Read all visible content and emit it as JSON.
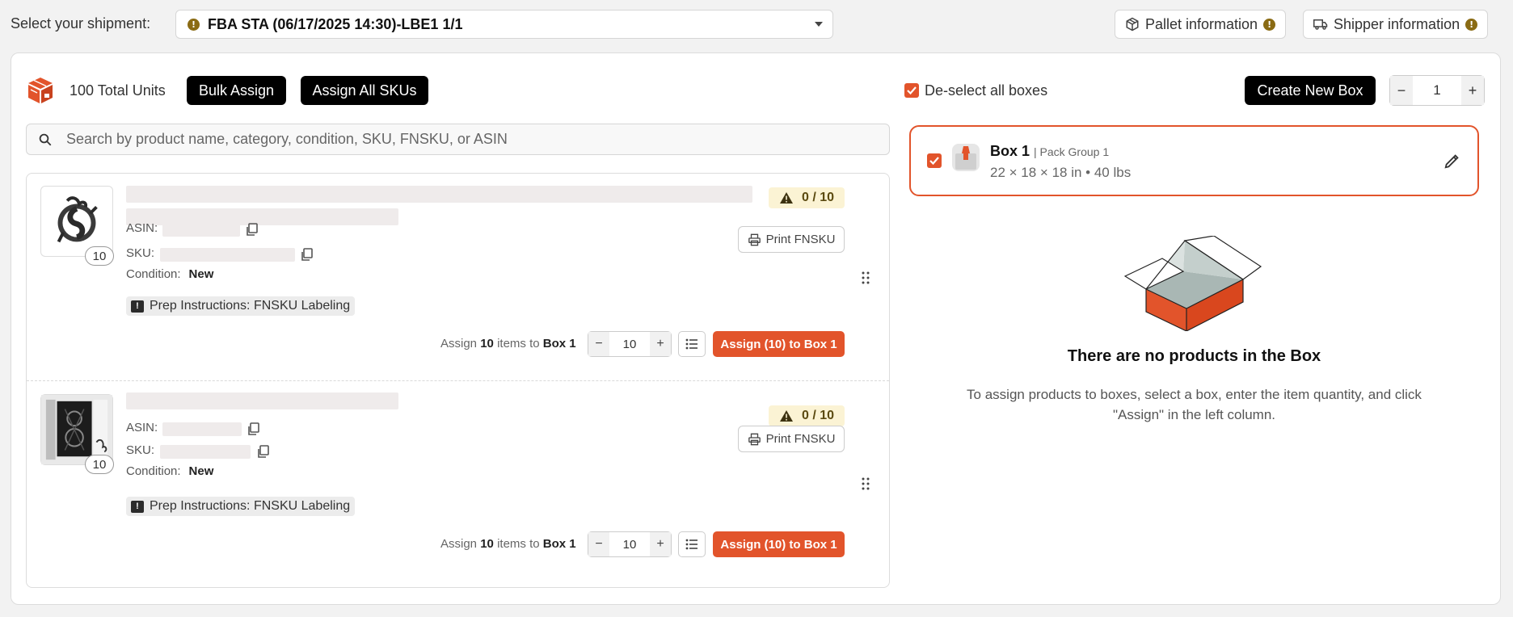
{
  "top": {
    "shipment_label": "Select your shipment:",
    "shipment_value": "FBA STA (06/17/2025 14:30)-LBE1 1/1",
    "pallet_btn": "Pallet information",
    "shipper_btn": "Shipper information",
    "warn_glyph": "!"
  },
  "toolbar": {
    "total_units": "100 Total Units",
    "bulk_assign": "Bulk Assign",
    "assign_all": "Assign All SKUs",
    "search_placeholder": "Search by product name, category, condition, SKU, FNSKU, or ASIN"
  },
  "products": [
    {
      "image_count": "10",
      "asin_label": "ASIN:",
      "sku_label": "SKU:",
      "condition_label": "Condition:",
      "condition_value": "New",
      "prep": "Prep Instructions: FNSKU Labeling",
      "qty_badge": "0 / 10",
      "print_label": "Print FNSKU",
      "assign_prefix": "Assign",
      "assign_count": "10",
      "assign_middle": "items to",
      "assign_box": "Box 1",
      "stepper_value": "10",
      "assign_button": "Assign (10) to Box 1"
    },
    {
      "image_count": "10",
      "asin_label": "ASIN:",
      "sku_label": "SKU:",
      "condition_label": "Condition:",
      "condition_value": "New",
      "prep": "Prep Instructions: FNSKU Labeling",
      "qty_badge": "0 / 10",
      "print_label": "Print FNSKU",
      "assign_prefix": "Assign",
      "assign_count": "10",
      "assign_middle": "items to",
      "assign_box": "Box 1",
      "stepper_value": "10",
      "assign_button": "Assign (10) to Box 1"
    }
  ],
  "right": {
    "deselect_label": "De-select all boxes",
    "create_box": "Create New Box",
    "box_count": "1",
    "box": {
      "name": "Box 1",
      "group": "| Pack Group 1",
      "dims": "22 × 18 × 18 in • 40 lbs"
    },
    "empty_title": "There are no products in the Box",
    "empty_desc": "To assign products to boxes, select a box, enter the item quantity, and click \"Assign\" in the left column."
  },
  "colors": {
    "accent": "#e2542b",
    "warning": "#8a6b14",
    "badge_bg": "#fbf3d4"
  }
}
